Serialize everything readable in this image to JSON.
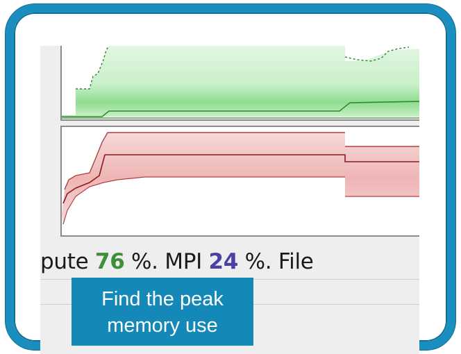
{
  "summary": {
    "prefix": "pute ",
    "compute_percent": "76",
    "mid1": " %. MPI ",
    "mpi_percent": "24",
    "mid2": " %. File"
  },
  "caption": {
    "text": "Find the peak memory use"
  },
  "colors": {
    "frame": "#1a8fbf",
    "caption_bg": "#1489b8",
    "green_fill": "#c8eec8",
    "green_line": "#2e8b2e",
    "red_fill": "#f2c4c4",
    "red_line": "#8b1a1a",
    "compute_value": "#3f8f3a",
    "mpi_value": "#4b3fa8"
  }
}
